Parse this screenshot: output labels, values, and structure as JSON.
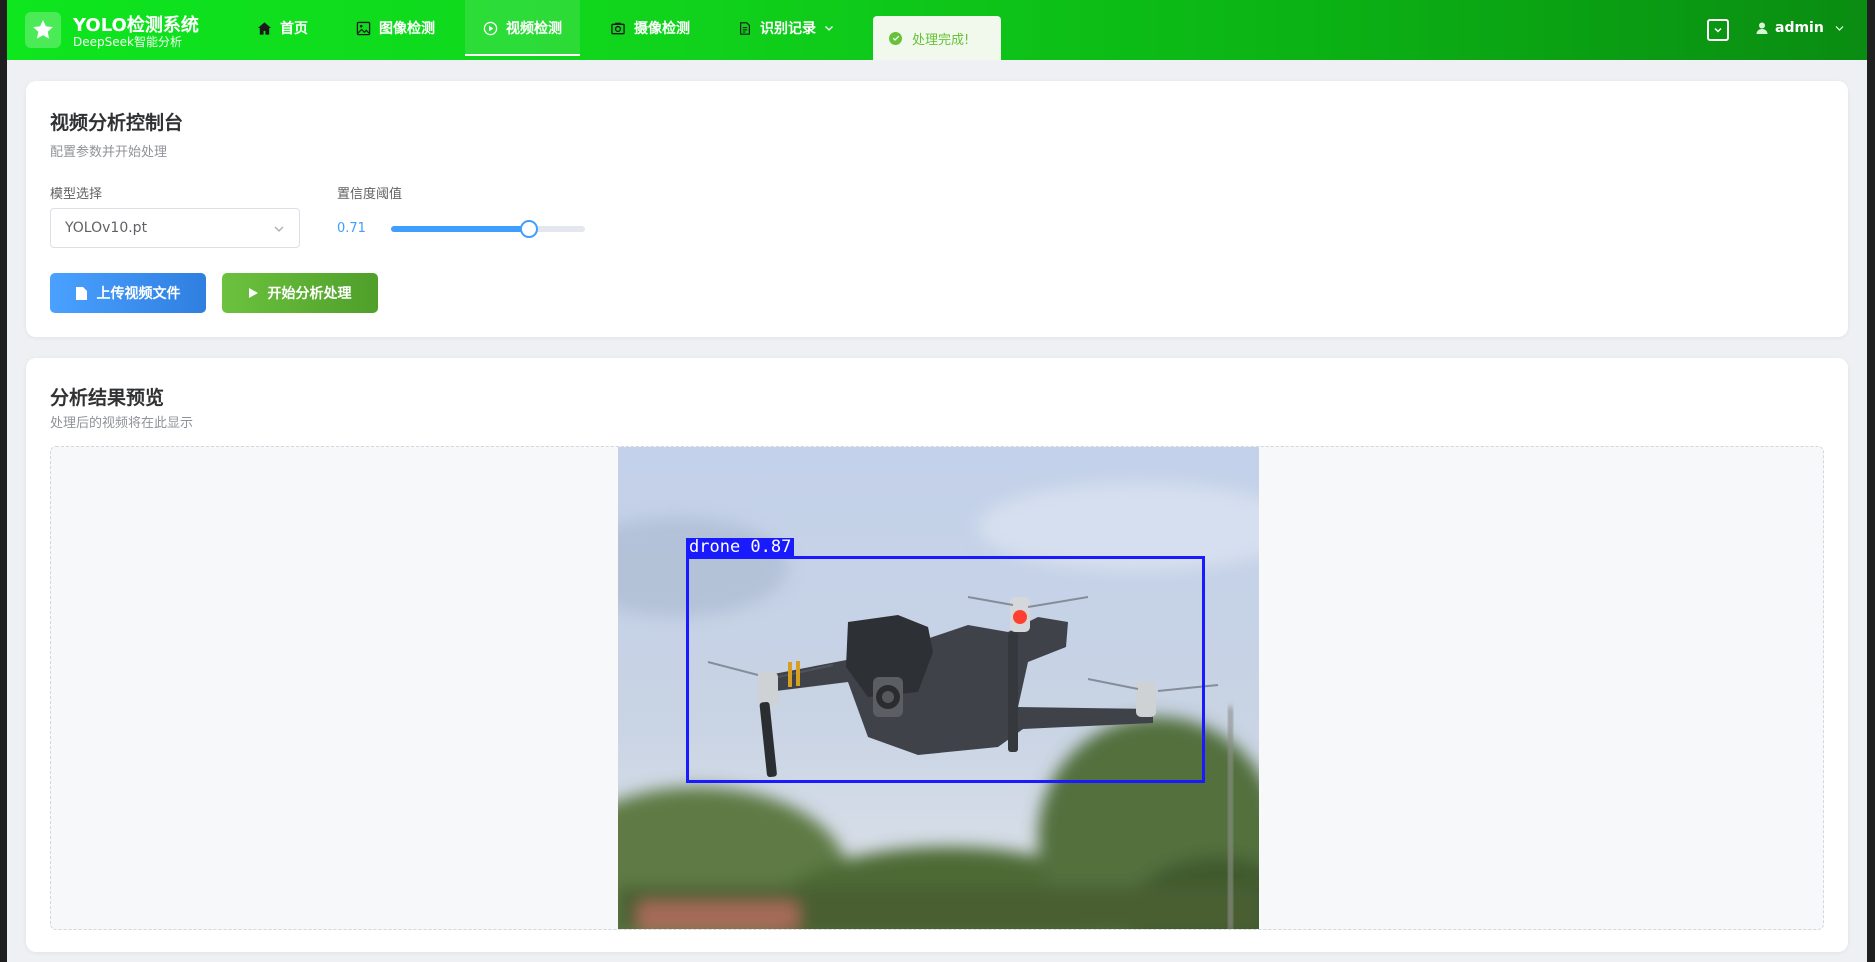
{
  "header": {
    "title": "YOLO检测系统",
    "subtitle": "DeepSeek智能分析",
    "nav": [
      {
        "label": "首页",
        "icon": "home-icon"
      },
      {
        "label": "图像检测",
        "icon": "image-icon"
      },
      {
        "label": "视频检测",
        "icon": "video-play-icon",
        "active": true
      },
      {
        "label": "摄像检测",
        "icon": "camera-icon"
      },
      {
        "label": "识别记录",
        "icon": "document-icon"
      }
    ],
    "toast": "处理完成!",
    "user": "admin"
  },
  "control": {
    "title": "视频分析控制台",
    "subtitle": "配置参数并开始处理",
    "model_label": "模型选择",
    "model_value": "YOLOv10.pt",
    "conf_label": "置信度阈值",
    "conf_value": "0.71",
    "conf_fraction": 0.71,
    "upload_label": "上传视频文件",
    "start_label": "开始分析处理"
  },
  "preview": {
    "title": "分析结果预览",
    "subtitle": "处理后的视频将在此显示",
    "detection_label": "drone 0.87"
  },
  "colors": {
    "header_green": "#0ee61e",
    "primary": "#409eff",
    "success": "#67c23a",
    "detection_box": "#1a1aff"
  }
}
